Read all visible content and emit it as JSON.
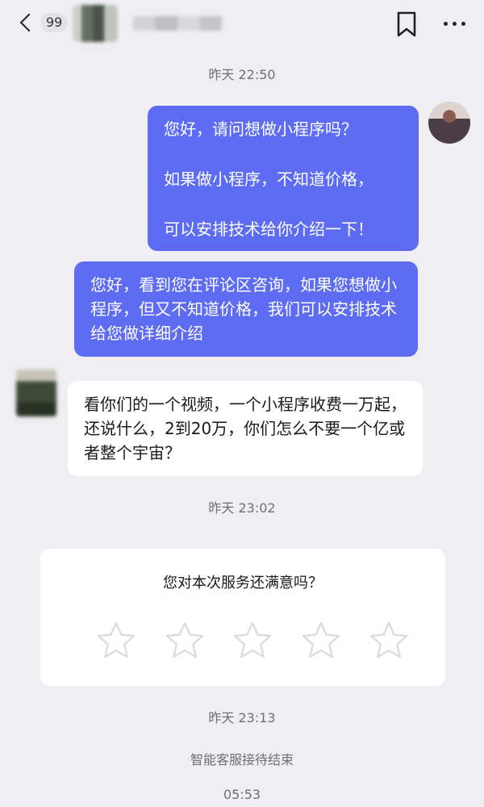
{
  "header": {
    "unread_badge": "99"
  },
  "timestamps": [
    "昨天 22:50",
    "昨天 23:02",
    "昨天 23:13",
    "05:53"
  ],
  "messages": [
    {
      "sender": "me",
      "paragraphs": [
        "您好，请问想做小程序吗？",
        "如果做小程序，不知道价格，",
        "可以安排技术给你介绍一下！"
      ]
    },
    {
      "sender": "me",
      "text": "您好，看到您在评论区咨询，如果您想做小程序，但又不知道价格，我们可以安排技术给您做详细介绍"
    },
    {
      "sender": "other",
      "text": "看你们的一个视频，一个小程序收费一万起，还说什么，2到20万，你们怎么不要一个亿或者整个宇宙？"
    }
  ],
  "rating": {
    "question": "您对本次服务还满意吗？",
    "stars_total": 5,
    "stars_selected": 0
  },
  "system_notice": "智能客服接待结束",
  "colors": {
    "my_bubble": "#5d6cf2",
    "background": "#efeff3"
  }
}
